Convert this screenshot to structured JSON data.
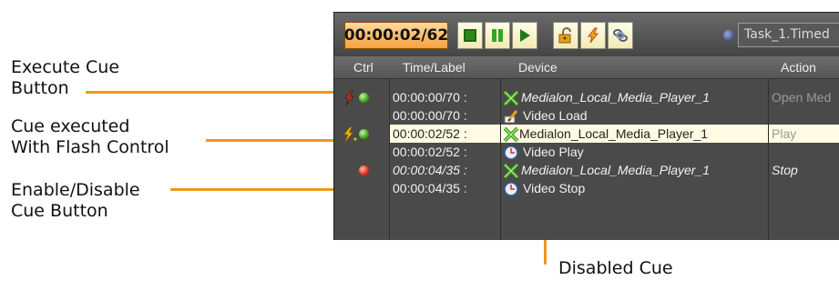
{
  "annotations": {
    "execute_cue": [
      "Execute Cue",
      "Button"
    ],
    "cue_executed": [
      "Cue executed",
      "With Flash Control"
    ],
    "enable_disable": [
      "Enable/Disable",
      "Cue Button"
    ],
    "disabled_cue": "Disabled Cue"
  },
  "toolbar": {
    "timer": "00:00:02/62",
    "task_field": "Task_1.Timed"
  },
  "columns": {
    "ctrl": "Ctrl",
    "time_label": "Time/Label",
    "device": "Device",
    "action": "Action"
  },
  "rows": [
    {
      "time": "00:00:00/70 :",
      "device": "Medialon_Local_Media_Player_1",
      "action": "Open Med"
    },
    {
      "time": "00:00:00/70 :",
      "device": "Video Load",
      "action": ""
    },
    {
      "time": "00:00:02/52 :",
      "device": "Medialon_Local_Media_Player_1",
      "action": "Play"
    },
    {
      "time": "00:00:02/52 :",
      "device": "Video Play",
      "action": ""
    },
    {
      "time": "00:00:04/35 :",
      "device": "Medialon_Local_Media_Player_1",
      "action": "Stop"
    },
    {
      "time": "00:00:04/35 :",
      "device": "Video Stop",
      "action": ""
    }
  ],
  "colors": {
    "leader": "#f2961c",
    "timer_bg": "#f6a23f",
    "selected_row": "#fffbe3"
  }
}
